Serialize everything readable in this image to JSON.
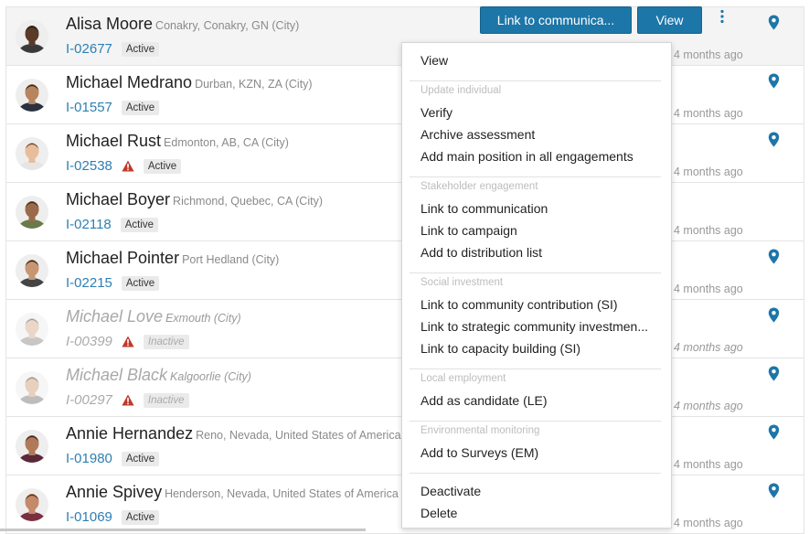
{
  "rows": [
    {
      "name": "Alisa Moore",
      "location": "Conakry, Conakry, GN (City)",
      "id": "I-02677",
      "status": "Active",
      "time": "4 months ago",
      "warn": false,
      "inactive": false,
      "pin": true,
      "skin": "#5a3a28",
      "hair": "#1a1a1a",
      "shirt": "#3a3a3a"
    },
    {
      "name": "Michael Medrano",
      "location": "Durban, KZN, ZA (City)",
      "id": "I-01557",
      "status": "Active",
      "time": "4 months ago",
      "warn": false,
      "inactive": false,
      "pin": true,
      "skin": "#b8845e",
      "hair": "#1f1a16",
      "shirt": "#2c3140"
    },
    {
      "name": "Michael Rust",
      "location": "Edmonton, AB, CA (City)",
      "id": "I-02538",
      "status": "Active",
      "time": "4 months ago",
      "warn": true,
      "inactive": false,
      "pin": true,
      "skin": "#e7bd9c",
      "hair": "#6b4a31",
      "shirt": "#e5e5e5"
    },
    {
      "name": "Michael Boyer",
      "location": "Richmond, Quebec, CA (City)",
      "id": "I-02118",
      "status": "Active",
      "time": "4 months ago",
      "warn": false,
      "inactive": false,
      "pin": false,
      "skin": "#9a6a4a",
      "hair": "#3b2a1e",
      "shirt": "#6a7a4a"
    },
    {
      "name": "Michael Pointer",
      "location": "Port Hedland (City)",
      "id": "I-02215",
      "status": "Active",
      "time": "4 months ago",
      "warn": false,
      "inactive": false,
      "pin": true,
      "skin": "#c79572",
      "hair": "#1e1a18",
      "shirt": "#444"
    },
    {
      "name": "Michael Love",
      "location": "Exmouth (City)",
      "id": "I-00399",
      "status": "Inactive",
      "time": "4 months ago",
      "warn": true,
      "inactive": true,
      "pin": true,
      "skin": "#d9b79c",
      "hair": "#5a4a3a",
      "shirt": "#9a9a9a"
    },
    {
      "name": "Michael Black",
      "location": "Kalgoorlie (City)",
      "id": "I-00297",
      "status": "Inactive",
      "time": "4 months ago",
      "warn": true,
      "inactive": true,
      "pin": true,
      "skin": "#d4aa88",
      "hair": "#4a3a2a",
      "shirt": "#888"
    },
    {
      "name": "Annie Hernandez",
      "location": "Reno, Nevada, United States of America",
      "id": "I-01980",
      "status": "Active",
      "time": "4 months ago",
      "warn": false,
      "inactive": false,
      "pin": true,
      "skin": "#b07a5a",
      "hair": "#2a1a12",
      "shirt": "#5a2a3a"
    },
    {
      "name": "Annie Spivey",
      "location": "Henderson, Nevada, United States of America",
      "id": "I-01069",
      "status": "Active",
      "time": "4 months ago",
      "warn": false,
      "inactive": false,
      "pin": true,
      "skin": "#c48a6a",
      "hair": "#4a2a1a",
      "shirt": "#7a3040"
    }
  ],
  "actions": {
    "link_label": "Link to communica...",
    "view_label": "View"
  },
  "menu": {
    "view": "View",
    "h_update": "Update individual",
    "verify": "Verify",
    "archive": "Archive assessment",
    "add_main": "Add main position in all engagements",
    "h_stakeholder": "Stakeholder engagement",
    "link_comm": "Link to communication",
    "link_campaign": "Link to campaign",
    "add_dist": "Add to distribution list",
    "h_social": "Social investment",
    "link_contrib": "Link to community contribution (SI)",
    "link_strategic": "Link to strategic community investmen...",
    "link_capacity": "Link to capacity building (SI)",
    "h_local": "Local employment",
    "add_candidate": "Add as candidate (LE)",
    "h_env": "Environmental monitoring",
    "add_surveys": "Add to Surveys (EM)",
    "deactivate": "Deactivate",
    "delete": "Delete"
  },
  "colors": {
    "accent": "#1d76a8",
    "link": "#2d7fb3",
    "warn": "#c0392b",
    "pin": "#1d76a8"
  }
}
